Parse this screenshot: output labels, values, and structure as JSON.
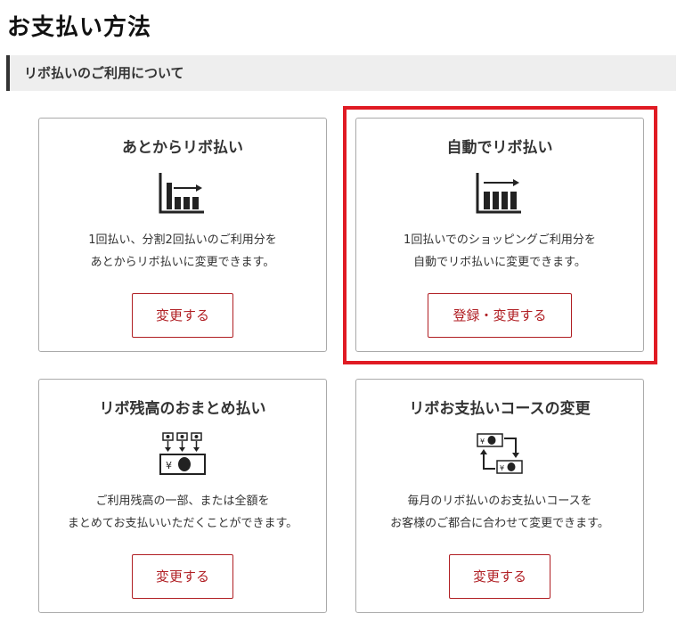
{
  "page": {
    "title": "お支払い方法",
    "section_title": "リボ払いのご利用について"
  },
  "cards": [
    {
      "title": "あとからリボ払い",
      "icon": "bar-chart-arrow-icon",
      "desc_line1": "1回払い、分割2回払いのご利用分を",
      "desc_line2": "あとからリボ払いに変更できます。",
      "button_label": "変更する"
    },
    {
      "title": "自動でリボ払い",
      "icon": "bar-chart-auto-icon",
      "desc_line1": "1回払いでのショッピングご利用分を",
      "desc_line2": "自動でリボ払いに変更できます。",
      "button_label": "登録・変更する"
    },
    {
      "title": "リボ残高のおまとめ払い",
      "icon": "consolidate-payment-icon",
      "desc_line1": "ご利用残高の一部、または全額を",
      "desc_line2": "まとめてお支払いいただくことができます。",
      "button_label": "変更する"
    },
    {
      "title": "リボお支払いコースの変更",
      "icon": "exchange-bills-icon",
      "desc_line1": "毎月のリボ払いのお支払いコースを",
      "desc_line2": "お客様のご都合に合わせて変更できます。",
      "button_label": "変更する"
    }
  ],
  "icon_text": {
    "yen_symbol": "¥"
  },
  "colors": {
    "accent": "#b01e23",
    "highlight": "#e01b24",
    "header_bg": "#eeeeee"
  }
}
